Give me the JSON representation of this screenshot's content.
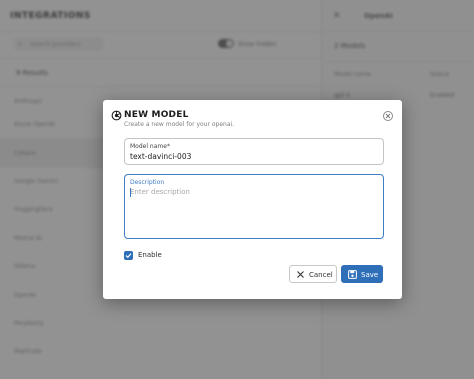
{
  "background": {
    "header_title": "INTEGRATIONS",
    "search_placeholder": "Search providers",
    "toggle_label": "Show hidden",
    "count_label": "9 Results",
    "list_items": [
      "Anthropic",
      "Azure OpenAI",
      "Cohere",
      "Google Gemini",
      "HuggingFace",
      "Mistral AI",
      "Ollama",
      "OpenAI",
      "Perplexity",
      "Replicate",
      "Together AI",
      "Vertex AI"
    ],
    "right_panel": {
      "title": "OpenAI",
      "count_label": "2 Models",
      "head_name": "Model name",
      "head_status": "Status",
      "cell_name": "gpt-4",
      "cell_status": "Enabled"
    }
  },
  "modal": {
    "title": "NEW MODEL",
    "subtitle": "Create a new model for your openai.",
    "model_name_label": "Model name",
    "model_name_required": "*",
    "model_name_value": "text-davinci-003",
    "description_label": "Description",
    "description_placeholder": "Enter description",
    "description_value": "",
    "enable_label": "Enable",
    "enable_checked": true,
    "cancel_label": "Cancel",
    "save_label": "Save"
  },
  "colors": {
    "accent": "#2f6fb8",
    "focus": "#3d7ec5",
    "overlay": "#1e1e1e"
  },
  "icons": {
    "logo": "openai-logo-icon",
    "close": "close-circle-icon",
    "checkbox": "checkmark-icon",
    "cancel": "cancel-x-icon",
    "save": "floppy-disk-icon"
  }
}
